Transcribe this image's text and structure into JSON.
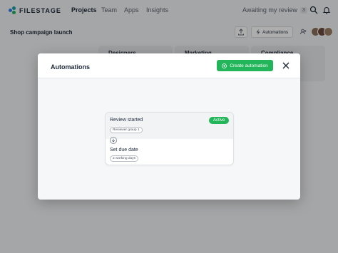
{
  "app": {
    "logo_text": "FILESTAGE",
    "nav": [
      {
        "label": "Projects"
      },
      {
        "label": "Team"
      },
      {
        "label": "Apps"
      },
      {
        "label": "Insights"
      }
    ],
    "awaiting_label": "Awaiting my review",
    "awaiting_count": "3",
    "project_title": "Shop campaign launch",
    "automations_button": "Automations",
    "columns": [
      {
        "title": "Designers"
      },
      {
        "title": "Marketing"
      },
      {
        "title": "Compliance"
      }
    ],
    "colors": {
      "logo_blue": "#2f80ed",
      "logo_green": "#22b55a",
      "logo_teal": "#18a0a8"
    }
  },
  "modal": {
    "title": "Automations",
    "create_button": "Create automation",
    "accent": "#22b55a",
    "automation": {
      "trigger_title": "Review started",
      "trigger_chip": "Reviewer group 1",
      "status": "Active",
      "action_title": "Set due date",
      "action_chip": "2 working days"
    }
  }
}
